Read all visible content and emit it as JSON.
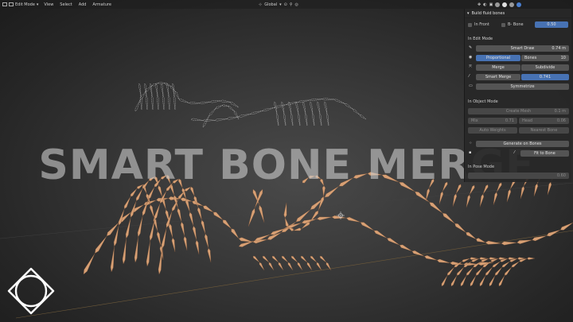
{
  "header": {
    "mode": "Edit Mode",
    "menus": [
      "View",
      "Select",
      "Add",
      "Armature"
    ],
    "transform_orientation": "Global"
  },
  "overlay_title": "SMART BONE MERGE",
  "panel": {
    "title": "Build fluid bones",
    "in_front_label": "In Front",
    "b_bone_label": "B- Bone",
    "b_bone_value": "0.50",
    "section_edit": "In Edit Mode",
    "smart_draw_label": "Smart Draw",
    "smart_draw_value": "0.74 m",
    "proportional_label": "Proportional",
    "bones_label": "Bones",
    "bones_value": "10",
    "merge_label": "Merge",
    "subdivide_label": "Subdivide",
    "smart_merge_label": "Smart Merge",
    "smart_merge_value": "0.741",
    "symmetrize_label": "Symmetrize",
    "section_object": "In Object Mode",
    "create_mesh_label": "Create Mesh",
    "create_mesh_value": "0.1 m",
    "mix_label": "Mix",
    "mix_value": "0.71",
    "head_label": "Head",
    "head_value": "0.06",
    "auto_weights_label": "Auto Weights",
    "nearest_bone_label": "Nearest Bone",
    "generate_label": "Generate on Bones",
    "fit_label": "Fit to Bone",
    "section_pose": "In Pose Mode",
    "pose_value": "0.60"
  },
  "colors": {
    "bone": "#d8a074",
    "bone_dark": "#7a5238",
    "ghost": "#c8c8c8",
    "accent": "#4772b3"
  }
}
